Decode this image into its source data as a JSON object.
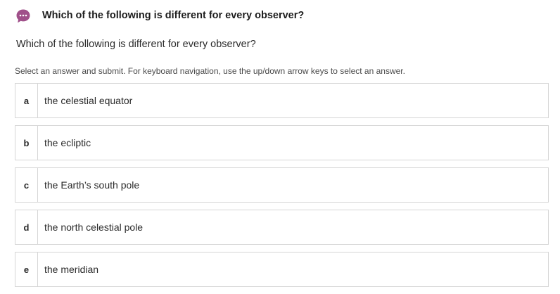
{
  "header": {
    "icon": "chat-bubble-icon",
    "icon_color": "#a0508a",
    "title": "Which of the following is different for every observer?"
  },
  "question": {
    "text": "Which of the following is different for every observer?"
  },
  "instructions": "Select an answer and submit. For keyboard navigation, use the up/down arrow keys to select an answer.",
  "options": [
    {
      "letter": "a",
      "text": "the celestial equator"
    },
    {
      "letter": "b",
      "text": "the ecliptic"
    },
    {
      "letter": "c",
      "text": "the Earth’s south pole"
    },
    {
      "letter": "d",
      "text": "the north celestial pole"
    },
    {
      "letter": "e",
      "text": "the meridian"
    }
  ]
}
